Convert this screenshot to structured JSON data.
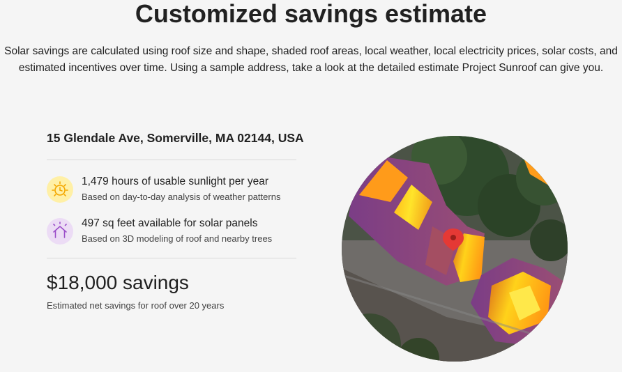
{
  "header": {
    "title": "Customized savings estimate",
    "intro": "Solar savings are calculated using roof size and shape, shaded roof areas, local weather, local electricity prices, solar costs, and estimated incentives over time. Using a sample address, take a look at the detailed estimate Project Sunroof can give you."
  },
  "estimate": {
    "address": "15 Glendale Ave, Somerville, MA 02144, USA",
    "features": [
      {
        "icon": "sun-clock-icon",
        "main": "1,479 hours of usable sunlight per year",
        "sub": "Based on day-to-day analysis of weather patterns"
      },
      {
        "icon": "house-icon",
        "main": "497 sq feet available for solar panels",
        "sub": "Based on 3D modeling of roof and nearby trees"
      }
    ],
    "savings": "$18,000 savings",
    "savings_note": "Estimated net savings for roof over 20 years"
  },
  "map": {
    "marker": "map-pin-icon"
  },
  "colors": {
    "sun_icon_bg": "#fff0a6",
    "sun_icon_stroke": "#f4a800",
    "house_icon_bg": "#ecdcf5",
    "house_icon_stroke": "#9c4fc9",
    "pin": "#e53935"
  }
}
